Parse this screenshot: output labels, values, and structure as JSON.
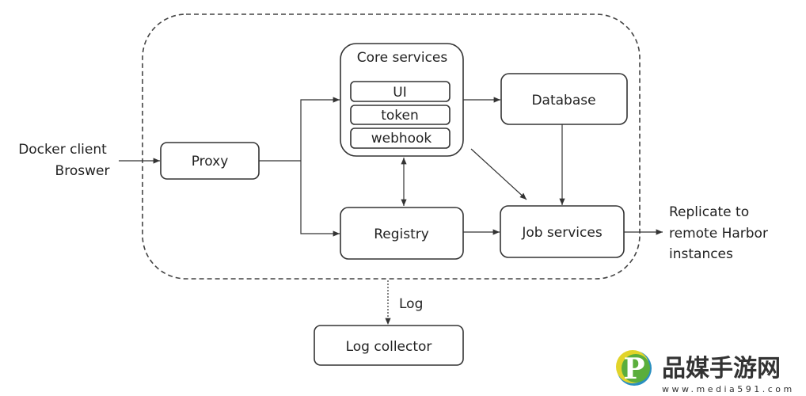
{
  "diagram": {
    "client_lines": [
      "Docker client",
      "Broswer"
    ],
    "proxy": "Proxy",
    "core_services": {
      "title": "Core services",
      "components": [
        "UI",
        "token",
        "webhook"
      ]
    },
    "database": "Database",
    "registry": "Registry",
    "job_services": "Job services",
    "replicate_lines": [
      "Replicate to",
      "remote Harbor",
      "instances"
    ],
    "log_label": "Log",
    "log_collector": "Log collector"
  },
  "watermark": {
    "logo_letter": "P",
    "name": "品媒手游网",
    "url": "www.media591.com",
    "colors": {
      "green": "#5aae3c",
      "yellow": "#e2d42a",
      "blue": "#2a8fc0"
    }
  }
}
